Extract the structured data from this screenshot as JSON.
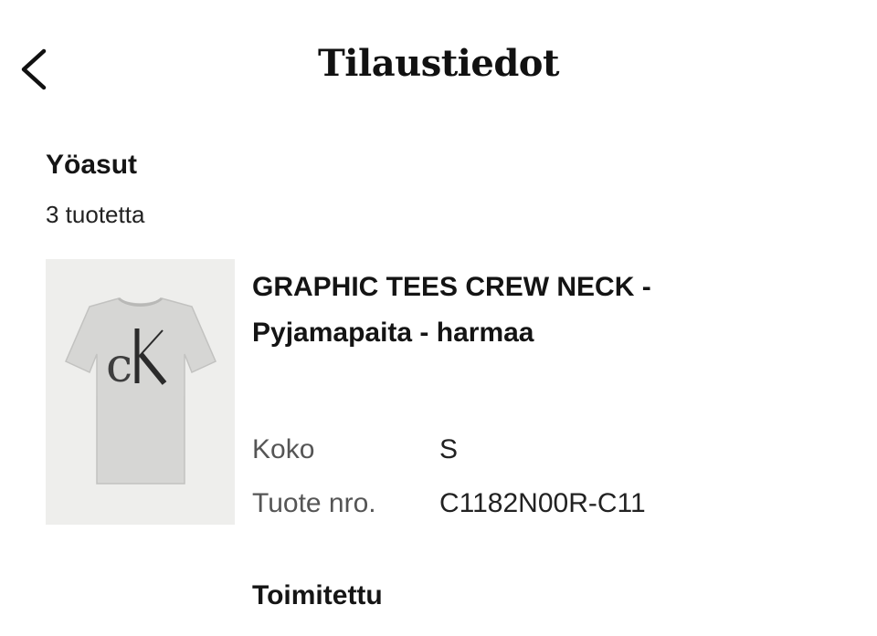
{
  "header": {
    "title": "Tilaustiedot",
    "back_icon": "chevron-left-icon"
  },
  "section": {
    "title": "Yöasut",
    "item_count": "3 tuotetta"
  },
  "product": {
    "image_icon": "tshirt-image",
    "image_logo_text": "CK",
    "name_line1": "GRAPHIC TEES CREW NECK -",
    "name_line2": "Pyjamapaita - harmaa",
    "size_label": "Koko",
    "size_value": "S",
    "sku_label": "Tuote nro.",
    "sku_value": "C1182N00R-C11"
  },
  "delivery": {
    "status": "Toimitettu"
  }
}
